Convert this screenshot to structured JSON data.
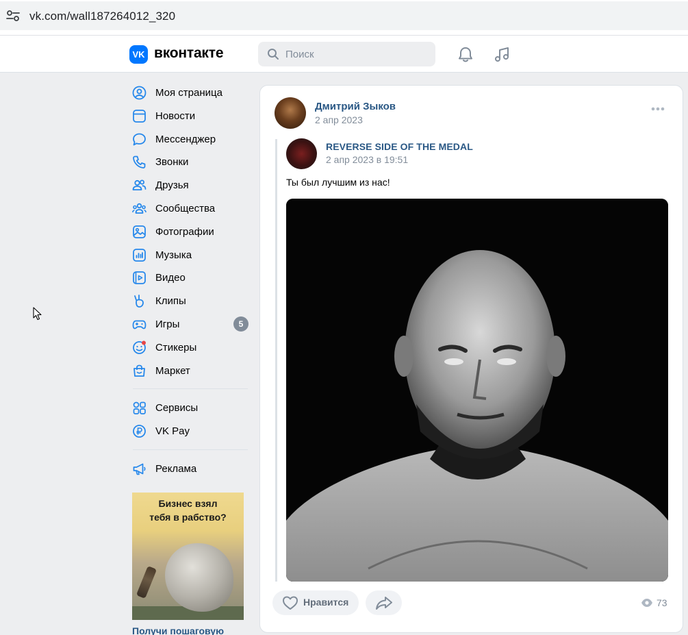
{
  "browser": {
    "url": "vk.com/wall187264012_320"
  },
  "header": {
    "logo_mark": "VK",
    "wordmark": "вконтакте",
    "search_placeholder": "Поиск",
    "accent": "#0077ff"
  },
  "sidebar": {
    "items": [
      {
        "label": "Моя страница",
        "icon": "user-circle-icon"
      },
      {
        "label": "Новости",
        "icon": "news-icon"
      },
      {
        "label": "Мессенджер",
        "icon": "message-icon"
      },
      {
        "label": "Звонки",
        "icon": "phone-icon"
      },
      {
        "label": "Друзья",
        "icon": "friends-icon"
      },
      {
        "label": "Сообщества",
        "icon": "communities-icon"
      },
      {
        "label": "Фотографии",
        "icon": "photos-icon"
      },
      {
        "label": "Музыка",
        "icon": "music-icon"
      },
      {
        "label": "Видео",
        "icon": "video-icon"
      },
      {
        "label": "Клипы",
        "icon": "clips-icon"
      },
      {
        "label": "Игры",
        "icon": "games-icon",
        "badge": "5"
      },
      {
        "label": "Стикеры",
        "icon": "stickers-icon"
      },
      {
        "label": "Маркет",
        "icon": "market-icon"
      }
    ],
    "extra_items": [
      {
        "label": "Сервисы",
        "icon": "services-icon"
      },
      {
        "label": "VK Pay",
        "icon": "vkpay-icon"
      }
    ],
    "ads_item": {
      "label": "Реклама",
      "icon": "megaphone-icon"
    },
    "ad": {
      "image_heading_line1": "Бизнес взял",
      "image_heading_line2": "тебя в рабство?",
      "title": "Получи пошаговую"
    }
  },
  "post": {
    "author": "Дмитрий Зыков",
    "date": "2 апр 2023",
    "repost": {
      "author": "REVERSE SIDE OF THE MEDAL",
      "date": "2 апр 2023 в 19:51",
      "text": "Ты был лучшим из нас!"
    },
    "like_label": "Нравится",
    "views": "73"
  }
}
